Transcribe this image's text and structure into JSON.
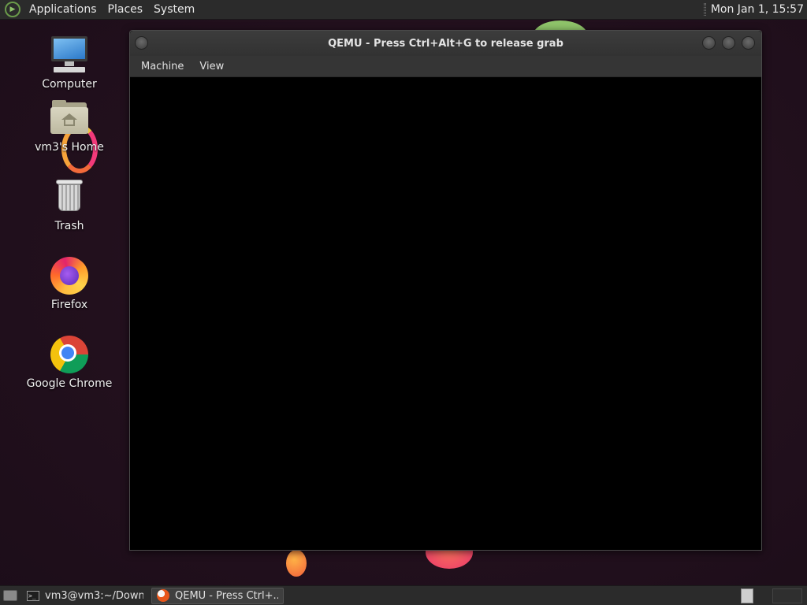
{
  "top_panel": {
    "menus": [
      "Applications",
      "Places",
      "System"
    ],
    "clock": "Mon Jan  1, 15:57"
  },
  "desktop": {
    "icons": [
      {
        "label": "Computer",
        "icon": "computer-icon"
      },
      {
        "label": "vm3's Home",
        "icon": "home-folder-icon"
      },
      {
        "label": "Trash",
        "icon": "trash-icon"
      },
      {
        "label": "Firefox",
        "icon": "firefox-icon"
      },
      {
        "label": "Google Chrome",
        "icon": "chrome-icon"
      }
    ]
  },
  "window": {
    "title": "QEMU - Press Ctrl+Alt+G to release grab",
    "menu": [
      "Machine",
      "View"
    ]
  },
  "taskbar": {
    "tasks": [
      {
        "label": "vm3@vm3:~/Downl...",
        "icon": "terminal-icon",
        "active": false
      },
      {
        "label": "QEMU - Press Ctrl+...",
        "icon": "qemu-icon",
        "active": true
      }
    ]
  },
  "colors": {
    "panel_bg": "#2b2b2b",
    "wallpaper": "#22101d",
    "guest_screen": "#000000"
  }
}
